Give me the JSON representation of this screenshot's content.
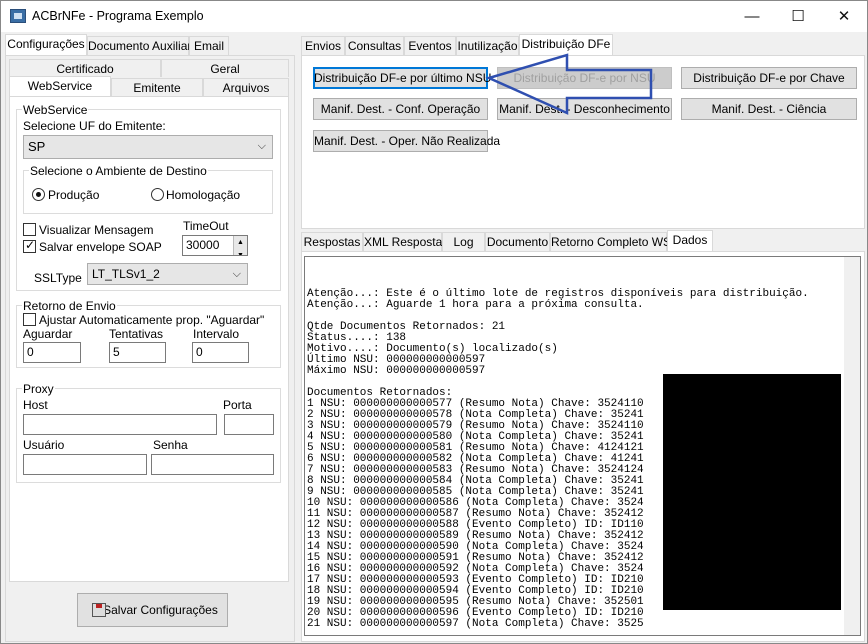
{
  "window": {
    "title": "ACBrNFe - Programa Exemplo",
    "minimize": "—",
    "maximize": "☐",
    "close": "✕"
  },
  "left": {
    "tabs": [
      "Configurações",
      "Documento Auxiliar",
      "Email"
    ],
    "subtabs_row1": [
      "Certificado",
      "Geral"
    ],
    "subtabs_row2": [
      "WebService",
      "Emitente",
      "Arquivos"
    ],
    "webservice": {
      "group_title": "WebService",
      "uf_label": "Selecione UF do Emitente:",
      "uf_value": "SP",
      "ambiente_title": "Selecione o Ambiente de Destino",
      "producao": "Produção",
      "homologacao": "Homologação",
      "visualizar": "Visualizar Mensagem",
      "salvar_envelope": "Salvar envelope SOAP",
      "timeout_label": "TimeOut",
      "timeout_value": "30000",
      "ssltype_label": "SSLType",
      "ssltype_value": "LT_TLSv1_2"
    },
    "retorno": {
      "title": "Retorno de Envio",
      "ajustar": "Ajustar Automaticamente prop. \"Aguardar\"",
      "aguardar_label": "Aguardar",
      "aguardar_value": "0",
      "tentativas_label": "Tentativas",
      "tentativas_value": "5",
      "intervalo_label": "Intervalo",
      "intervalo_value": "0"
    },
    "proxy": {
      "title": "Proxy",
      "host": "Host",
      "porta": "Porta",
      "usuario": "Usuário",
      "senha": "Senha"
    },
    "save_button": "Salvar Configurações"
  },
  "right": {
    "tabs": [
      "Envios",
      "Consultas",
      "Eventos",
      "Inutilização",
      "Distribuição DFe"
    ],
    "buttons": {
      "dist_ultimo_nsu": "Distribuição DF-e por último NSU",
      "dist_nsu": "Distribuição DF-e por NSU",
      "dist_chave": "Distribuição DF-e por Chave",
      "manif_conf": "Manif. Dest. - Conf. Operação",
      "manif_desc": "Manif. Dest. - Desconhecimento",
      "manif_ciencia": "Manif. Dest. - Ciência",
      "manif_nao_realizada": "Manif. Dest. - Oper. Não Realizada"
    },
    "bottom_tabs": [
      "Respostas",
      "XML Resposta",
      "Log",
      "Documento",
      "Retorno Completo WS",
      "Dados"
    ],
    "memo_lines": [
      "Atenção...: Este é o último lote de registros disponíveis para distribuição.",
      "Atenção...: Aguarde 1 hora para a próxima consulta.",
      "",
      "Qtde Documentos Retornados: 21",
      "Status....: 138",
      "Motivo....: Documento(s) localizado(s)",
      "Último NSU: 000000000000597",
      "Máximo NSU: 000000000000597",
      "",
      "Documentos Retornados:",
      "1 NSU: 000000000000577 (Resumo Nota) Chave: 3524110",
      "2 NSU: 000000000000578 (Nota Completa) Chave: 35241",
      "3 NSU: 000000000000579 (Resumo Nota) Chave: 3524110",
      "4 NSU: 000000000000580 (Nota Completa) Chave: 35241",
      "5 NSU: 000000000000581 (Resumo Nota) Chave: 4124121",
      "6 NSU: 000000000000582 (Nota Completa) Chave: 41241",
      "7 NSU: 000000000000583 (Resumo Nota) Chave: 3524124",
      "8 NSU: 000000000000584 (Nota Completa) Chave: 35241",
      "9 NSU: 000000000000585 (Nota Completa) Chave: 35241",
      "10 NSU: 000000000000586 (Nota Completa) Chave: 3524",
      "11 NSU: 000000000000587 (Resumo Nota) Chave: 352412",
      "12 NSU: 000000000000588 (Evento Completo) ID: ID110",
      "13 NSU: 000000000000589 (Resumo Nota) Chave: 352412",
      "14 NSU: 000000000000590 (Nota Completa) Chave: 3524",
      "15 NSU: 000000000000591 (Resumo Nota) Chave: 352412",
      "16 NSU: 000000000000592 (Nota Completa) Chave: 3524",
      "17 NSU: 000000000000593 (Evento Completo) ID: ID210",
      "18 NSU: 000000000000594 (Evento Completo) ID: ID210",
      "19 NSU: 000000000000595 (Resumo Nota) Chave: 352501",
      "20 NSU: 000000000000596 (Evento Completo) ID: ID210",
      "21 NSU: 000000000000597 (Nota Completa) Chave: 3525"
    ]
  },
  "colors": {
    "accent": "#0078d7",
    "arrow": "#2f4fb0"
  }
}
